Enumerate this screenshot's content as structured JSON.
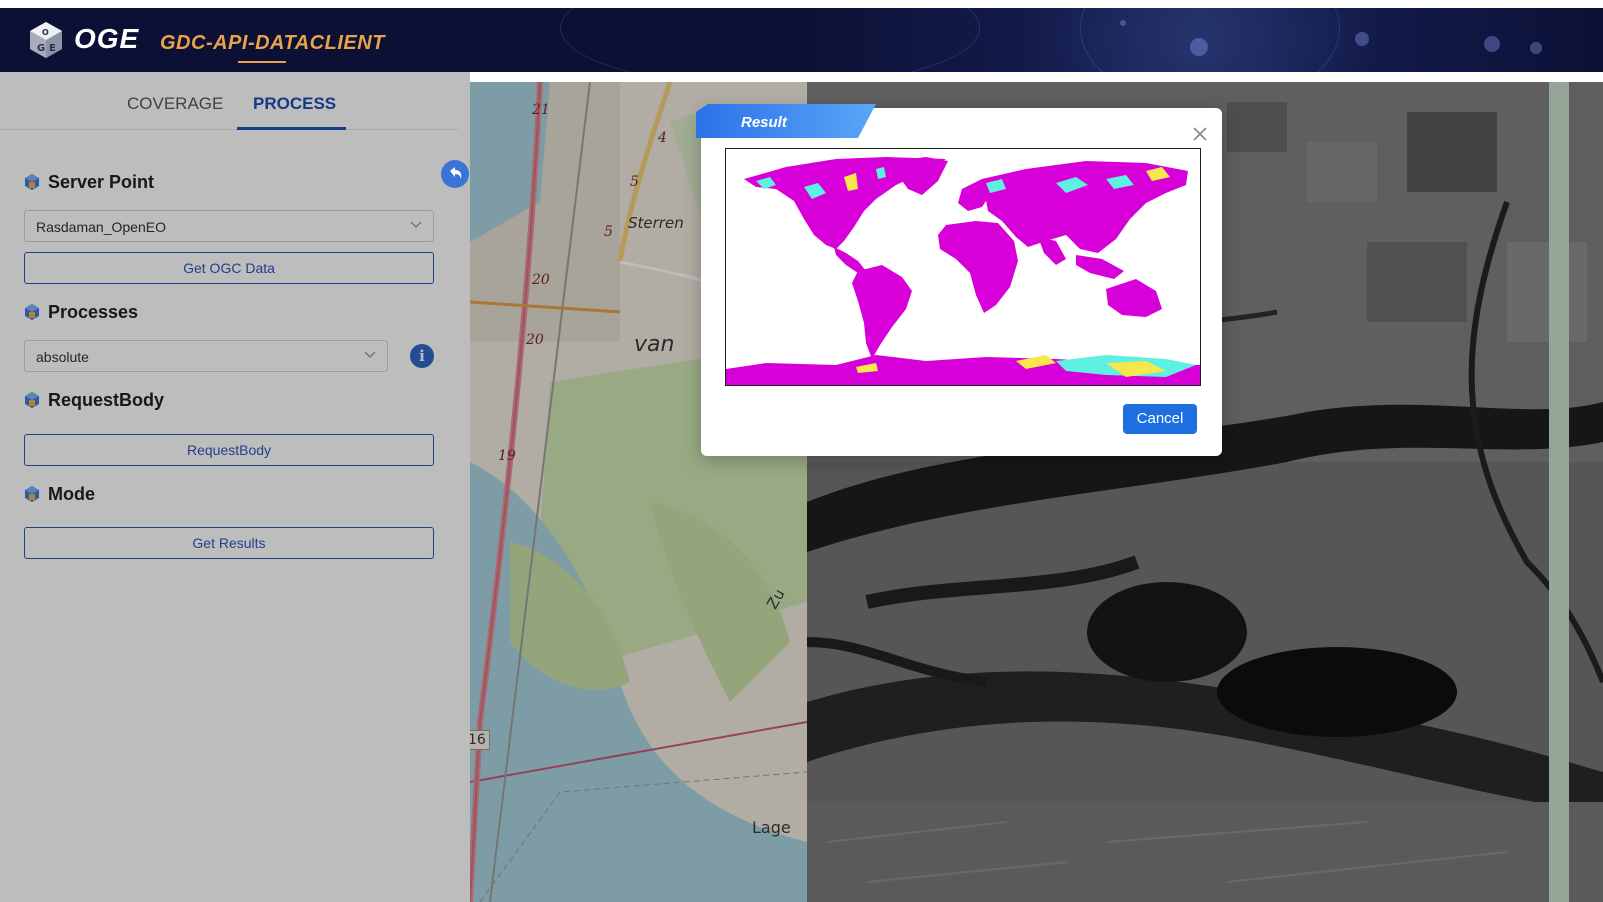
{
  "header": {
    "logo_text": "OGE",
    "app_title": "GDC-API-DATACLIENT"
  },
  "sidebar": {
    "tabs": [
      {
        "label": "COVERAGE",
        "active": false
      },
      {
        "label": "PROCESS",
        "active": true
      }
    ],
    "server_point": {
      "title": "Server Point",
      "selected": "Rasdaman_OpenEO",
      "button_label": "Get OGC Data"
    },
    "processes": {
      "title": "Processes",
      "selected": "absolute",
      "info_glyph": "i"
    },
    "request_body": {
      "title": "RequestBody",
      "button_label": "RequestBody"
    },
    "mode": {
      "title": "Mode",
      "button_label": "Get Results"
    }
  },
  "map": {
    "labels": {
      "sterrenburg": "Sterren",
      "van": "van",
      "zuid": "Zu",
      "lage": "Lage",
      "road_16": "16"
    },
    "road_numbers": [
      "21",
      "20",
      "20",
      "19",
      "4",
      "5",
      "5"
    ]
  },
  "dialog": {
    "title": "Result",
    "cancel_label": "Cancel",
    "colors": {
      "land": "#d800d8",
      "highlight_cyan": "#5ef0e0",
      "highlight_yellow": "#f6e84a",
      "accent": "#1d6fe0"
    }
  },
  "colors": {
    "header_bg": "#0b1034",
    "title_orange": "#e7a24a",
    "primary_blue": "#2d58b8"
  }
}
